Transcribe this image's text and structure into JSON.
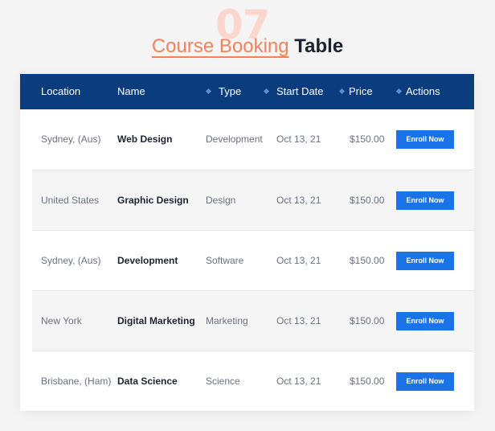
{
  "heading": {
    "number": "07",
    "accent": "Course Booking",
    "rest": "Table"
  },
  "colors": {
    "header_bg": "#0b3d7e",
    "accent": "#f4815e",
    "button": "#1a73e8"
  },
  "table": {
    "columns": [
      {
        "label": "Location",
        "sortable": false
      },
      {
        "label": "Name",
        "sortable": false
      },
      {
        "label": "Type",
        "sortable": true
      },
      {
        "label": "Start Date",
        "sortable": true
      },
      {
        "label": "Price",
        "sortable": true
      },
      {
        "label": "Actions",
        "sortable": true
      }
    ],
    "rows": [
      {
        "location": "Sydney, (Aus)",
        "name": "Web Design",
        "type": "Development",
        "start_date": "Oct 13, 21",
        "price": "$150.00",
        "action": "Enroll Now"
      },
      {
        "location": "United States",
        "name": "Graphic Design",
        "type": "Design",
        "start_date": "Oct 13, 21",
        "price": "$150.00",
        "action": "Enroll Now"
      },
      {
        "location": "Sydney, (Aus)",
        "name": "Development",
        "type": "Software",
        "start_date": "Oct 13, 21",
        "price": "$150.00",
        "action": "Enroll Now"
      },
      {
        "location": "New York",
        "name": "Digital Marketing",
        "type": "Marketing",
        "start_date": "Oct 13, 21",
        "price": "$150.00",
        "action": "Enroll Now"
      },
      {
        "location": "Brisbane, (Ham)",
        "name": "Data Science",
        "type": "Science",
        "start_date": "Oct 13, 21",
        "price": "$150.00",
        "action": "Enroll Now"
      }
    ]
  }
}
